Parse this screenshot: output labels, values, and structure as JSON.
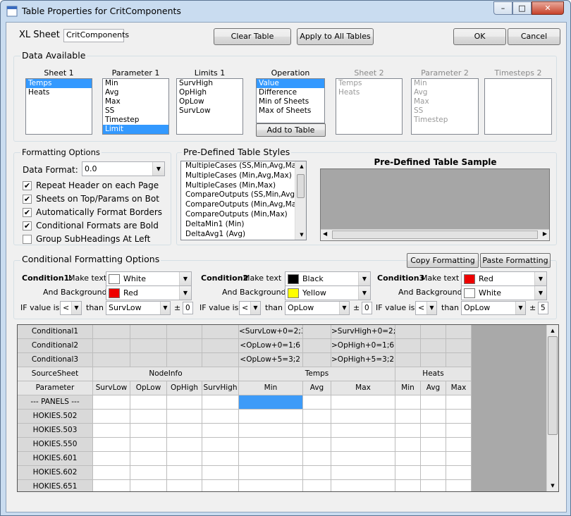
{
  "window": {
    "title": "Table Properties for CritComponents",
    "min_glyph": "–",
    "max_glyph": "□",
    "close_glyph": "✕"
  },
  "top": {
    "xl_sheet_label": "XL Sheet",
    "xl_sheet_value": "CritComponents",
    "clear_table": "Clear Table",
    "apply_all": "Apply to All Tables",
    "ok": "OK",
    "cancel": "Cancel"
  },
  "data_available": {
    "title": "Data Available",
    "sheet1": {
      "label": "Sheet 1",
      "items": [
        "Temps",
        "Heats"
      ]
    },
    "parameter1": {
      "label": "Parameter 1",
      "items": [
        "Min",
        "Avg",
        "Max",
        "SS",
        "Timestep",
        "Limit"
      ]
    },
    "limits1": {
      "label": "Limits 1",
      "items": [
        "SurvHigh",
        "OpHigh",
        "OpLow",
        "SurvLow"
      ]
    },
    "operation": {
      "label": "Operation",
      "items": [
        "Value",
        "Difference",
        "Min of Sheets",
        "Max of Sheets"
      ]
    },
    "add_to_table": "Add to Table",
    "sheet2": {
      "label": "Sheet 2",
      "items": [
        "Temps",
        "Heats"
      ]
    },
    "parameter2": {
      "label": "Parameter 2",
      "items": [
        "Min",
        "Avg",
        "Max",
        "SS",
        "Timestep"
      ]
    },
    "timesteps2": {
      "label": "Timesteps 2",
      "items": []
    }
  },
  "formatting": {
    "title": "Formatting Options",
    "data_format_label": "Data Format:",
    "data_format_value": "0.0",
    "checks": [
      {
        "label": "Repeat Header on each Page",
        "checked": true
      },
      {
        "label": "Sheets on Top/Params on Bot",
        "checked": true
      },
      {
        "label": "Automatically Format Borders",
        "checked": true
      },
      {
        "label": "Conditional Formats are Bold",
        "checked": true
      },
      {
        "label": "Group SubHeadings At Left",
        "checked": false
      }
    ]
  },
  "styles": {
    "title": "Pre-Defined Table Styles",
    "items": [
      "MultipleCases (SS,Min,Avg,Max)",
      "MultipleCases (Min,Avg,Max)",
      "MultipleCases (Min,Max)",
      "CompareOutputs (SS,Min,Avg,Max)",
      "CompareOutputs (Min,Avg,Max)",
      "CompareOutputs (Min,Max)",
      "DeltaMin1 (Min)",
      "DeltaAvg1 (Avg)"
    ],
    "sample_title": "Pre-Defined Table Sample"
  },
  "conditional": {
    "title": "Conditional Formatting Options",
    "copy": "Copy Formatting",
    "paste": "Paste Formatting",
    "make_text": "Make text",
    "and_background": "And Background",
    "if_value_is": "IF value is",
    "than": "than",
    "pm": "±",
    "conditions": [
      {
        "name": "Condition1:",
        "text_color": "White",
        "text_swatch": "#ffffff",
        "bg_color": "Red",
        "bg_swatch": "#ee0000",
        "op": "<",
        "limit": "SurvLow",
        "offset": "0"
      },
      {
        "name": "Condition2",
        "text_color": "Black",
        "text_swatch": "#000000",
        "bg_color": "Yellow",
        "bg_swatch": "#ffff00",
        "op": "<",
        "limit": "OpLow",
        "offset": "0"
      },
      {
        "name": "Condition3",
        "text_color": "Red",
        "text_swatch": "#ee0000",
        "bg_color": "White",
        "bg_swatch": "#ffffff",
        "op": "<",
        "limit": "OpLow",
        "offset": "5"
      }
    ]
  },
  "grid": {
    "cond_rows": [
      {
        "label": "Conditional1",
        "temps_min": "<SurvLow+0=2;3",
        "temps_max": ">SurvHigh+0=2;3"
      },
      {
        "label": "Conditional2",
        "temps_min": "<OpLow+0=1;6",
        "temps_max": ">OpHigh+0=1;6"
      },
      {
        "label": "Conditional3",
        "temps_min": "<OpLow+5=3;2",
        "temps_max": ">OpHigh+5=3;2"
      }
    ],
    "source_label": "SourceSheet",
    "parameter_label": "Parameter",
    "groups": [
      "NodeInfo",
      "Temps",
      "Heats"
    ],
    "columns": [
      "SurvLow",
      "OpLow",
      "OpHigh",
      "SurvHigh",
      "Min",
      "Avg",
      "Max",
      "Min",
      "Avg",
      "Max"
    ],
    "rows": [
      "--- PANELS ---",
      "HOKIES.502",
      "HOKIES.503",
      "HOKIES.550",
      "HOKIES.601",
      "HOKIES.602",
      "HOKIES.651"
    ]
  }
}
